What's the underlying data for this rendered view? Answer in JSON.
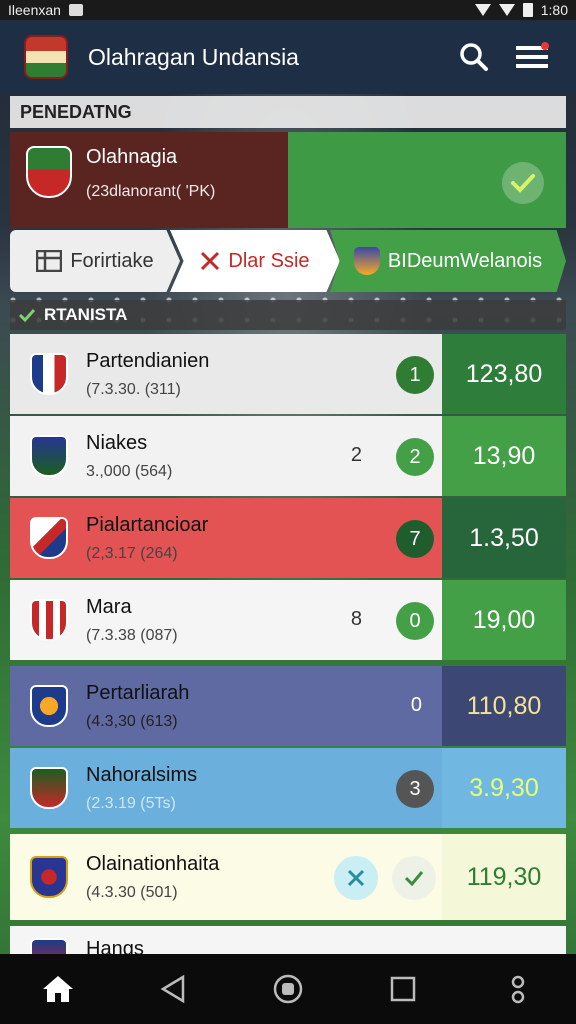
{
  "status_bar": {
    "carrier": "Ileenxan",
    "time": "1:80"
  },
  "app": {
    "title": "Olahragan Undansia"
  },
  "section1": {
    "title": "PENEDATNG"
  },
  "featured": {
    "title": "Olahnagia",
    "subtitle": "(23dlanorant( 'PK)",
    "colors": {
      "left": "#5a2520",
      "right": "#3f9a45"
    }
  },
  "tabs": [
    {
      "label": "Forirtiake",
      "icon": "table-icon"
    },
    {
      "label": "Dlar Ssie",
      "icon": "x-icon"
    },
    {
      "label": "BIDeumWelanois",
      "icon": "crest-icon"
    }
  ],
  "section2": {
    "title": "RTANISTA"
  },
  "matches": [
    {
      "name": "Partendianien",
      "sub": "(7.3.30. (311)",
      "count": "",
      "badge": "1",
      "odds": "123,80"
    },
    {
      "name": "Niakes",
      "sub": "3.,000 (564)",
      "count": "2",
      "badge": "2",
      "odds": "13,90"
    },
    {
      "name": "Pialartancioar",
      "sub": "(2,3.17 (264)",
      "count": "",
      "badge": "7",
      "odds": "1.3,50"
    },
    {
      "name": "Mara",
      "sub": "(7.3.38 (087)",
      "count": "8",
      "badge": "0",
      "odds": "19,00"
    },
    {
      "name": "Pertarliarah",
      "sub": "(4.3,30 (613)",
      "count": "0",
      "badge": "",
      "odds": "110,80"
    },
    {
      "name": "Nahoralsims",
      "sub": "(2.3.19 (5Ts)",
      "count": "",
      "badge": "3",
      "odds": "3.9,30"
    },
    {
      "name": "Olainationhaita",
      "sub": "(4.3.30 (501)",
      "count": "",
      "badge": "",
      "odds": "119,30"
    },
    {
      "name": "Hangs",
      "sub": "",
      "count": "",
      "badge": "",
      "odds": ""
    }
  ],
  "nav": [
    "home-icon",
    "back-icon",
    "assistant-icon",
    "recents-icon",
    "more-icon"
  ]
}
